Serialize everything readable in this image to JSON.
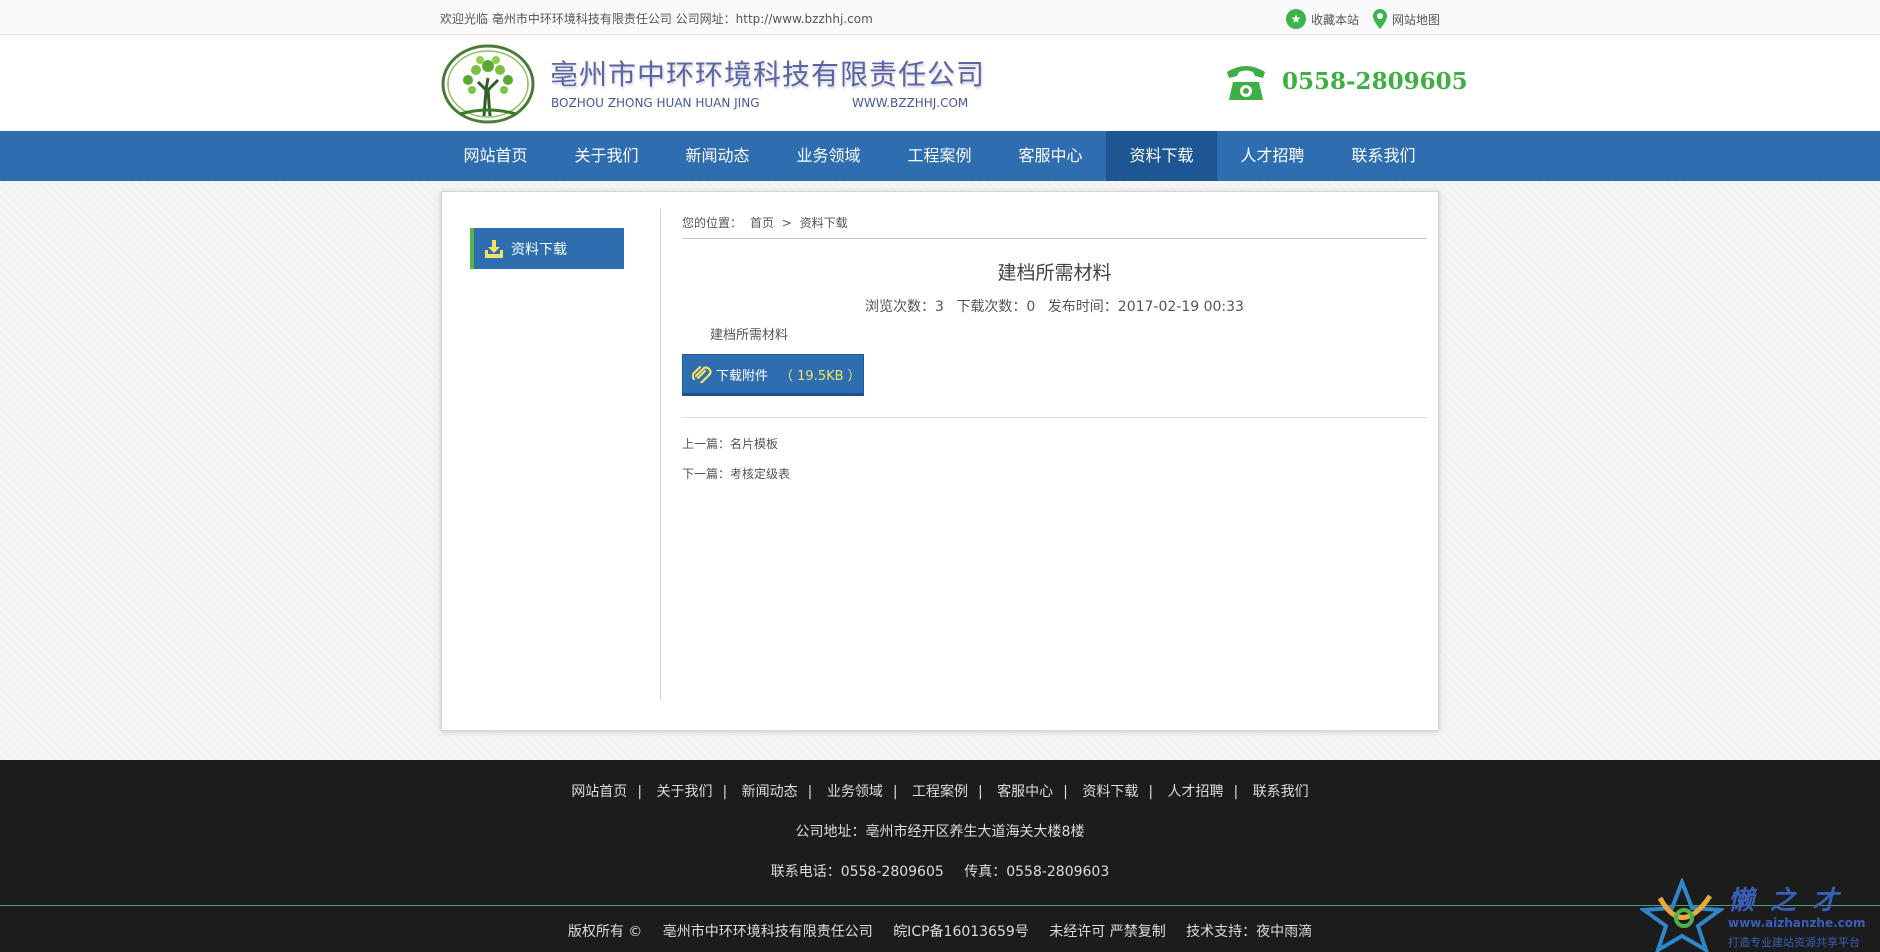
{
  "topbar": {
    "welcome": "欢迎光临 亳州市中环环境科技有限责任公司 公司网址：http://www.bzzhhj.com",
    "favorite_label": "收藏本站",
    "sitemap_label": "网站地图"
  },
  "header": {
    "company_name_cn": "亳州市中环环境科技有限责任公司",
    "company_name_en": "BOZHOU ZHONG HUAN HUAN JING",
    "company_url": "WWW.BZZHHJ.COM",
    "phone": "0558-2809605"
  },
  "nav": {
    "items": [
      {
        "label": "网站首页"
      },
      {
        "label": "关于我们"
      },
      {
        "label": "新闻动态"
      },
      {
        "label": "业务领域"
      },
      {
        "label": "工程案例"
      },
      {
        "label": "客服中心"
      },
      {
        "label": "资料下载"
      },
      {
        "label": "人才招聘"
      },
      {
        "label": "联系我们"
      }
    ],
    "active": "资料下载"
  },
  "sidebar": {
    "item_label": "资料下载"
  },
  "breadcrumb": {
    "prefix": "您的位置：",
    "home": "首页",
    "separator": ">",
    "current": "资料下载"
  },
  "article": {
    "title": "建档所需材料",
    "views_label": "浏览次数：3",
    "downloads_label": "下载次数：0",
    "published_label": "发布时间：2017-02-19 00:33",
    "body": "建档所需材料",
    "download_button_label": "下载附件",
    "download_size": "（ 19.5KB ）",
    "prev": "上一篇：名片模板",
    "next": "下一篇：考核定级表"
  },
  "footer": {
    "nav": [
      "网站首页",
      "关于我们",
      "新闻动态",
      "业务领域",
      "工程案例",
      "客服中心",
      "资料下载",
      "人才招聘",
      "联系我们"
    ],
    "nav_separator": "|",
    "address": "公司地址：亳州市经开区养生大道海关大楼8楼",
    "phone": "联系电话：0558-2809605",
    "fax": "传真：0558-2809603",
    "copyright": "版权所有 ©",
    "company": "亳州市中环环境科技有限责任公司",
    "icp": "皖ICP备16013659号",
    "notice": "未经许可 严禁复制",
    "support": "技术支持：夜中雨滴"
  },
  "watermark": {
    "brand": "懒之才",
    "url": "www.aizhanzhe.com",
    "slogan": "打造专业建站资源共享平台"
  },
  "colors": {
    "nav_blue": "#2e6eb0",
    "nav_active": "#1d5693",
    "green_accent": "#3fae44",
    "footer_bg": "#1c1c1c"
  },
  "icons": {
    "favorite": "star-icon",
    "sitemap": "location-pin-icon",
    "logo": "tree-logo-icon",
    "phone": "telephone-icon",
    "sidebar": "download-icon",
    "download_button": "paperclip-icon"
  }
}
